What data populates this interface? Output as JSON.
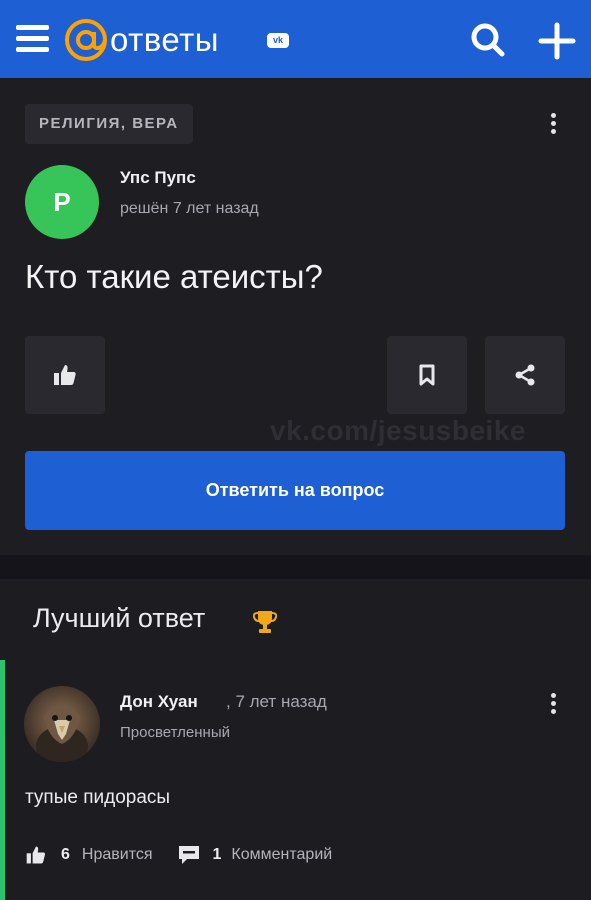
{
  "header": {
    "logo_text": "ответы",
    "logo_badge": "vk",
    "menu_icon": "hamburger-icon",
    "search_icon": "search-icon",
    "add_icon": "plus-icon"
  },
  "question": {
    "category": "РЕЛИГИЯ, ВЕРА",
    "author": {
      "initial": "Р",
      "name": "Упс Пупс",
      "meta": "решён 7 лет назад",
      "avatar_color": "#37c55a"
    },
    "title": "Кто такие атеисты?",
    "answer_button": "Ответить на вопрос"
  },
  "watermark": "vk.com/jesusbeike",
  "best_answer": {
    "heading": "Лучший ответ",
    "author": {
      "name": "Дон Хуан",
      "time": ", 7 лет назад",
      "rank": "Просветленный"
    },
    "text": "тупые пидорасы",
    "likes": "6",
    "likes_label": "Нравится",
    "comments": "1",
    "comments_label": "Комментарий"
  },
  "colors": {
    "brand_blue": "#1f5fd4",
    "background": "#1d1c21",
    "accent_green": "#29c46c",
    "trophy": "#f0a818"
  }
}
